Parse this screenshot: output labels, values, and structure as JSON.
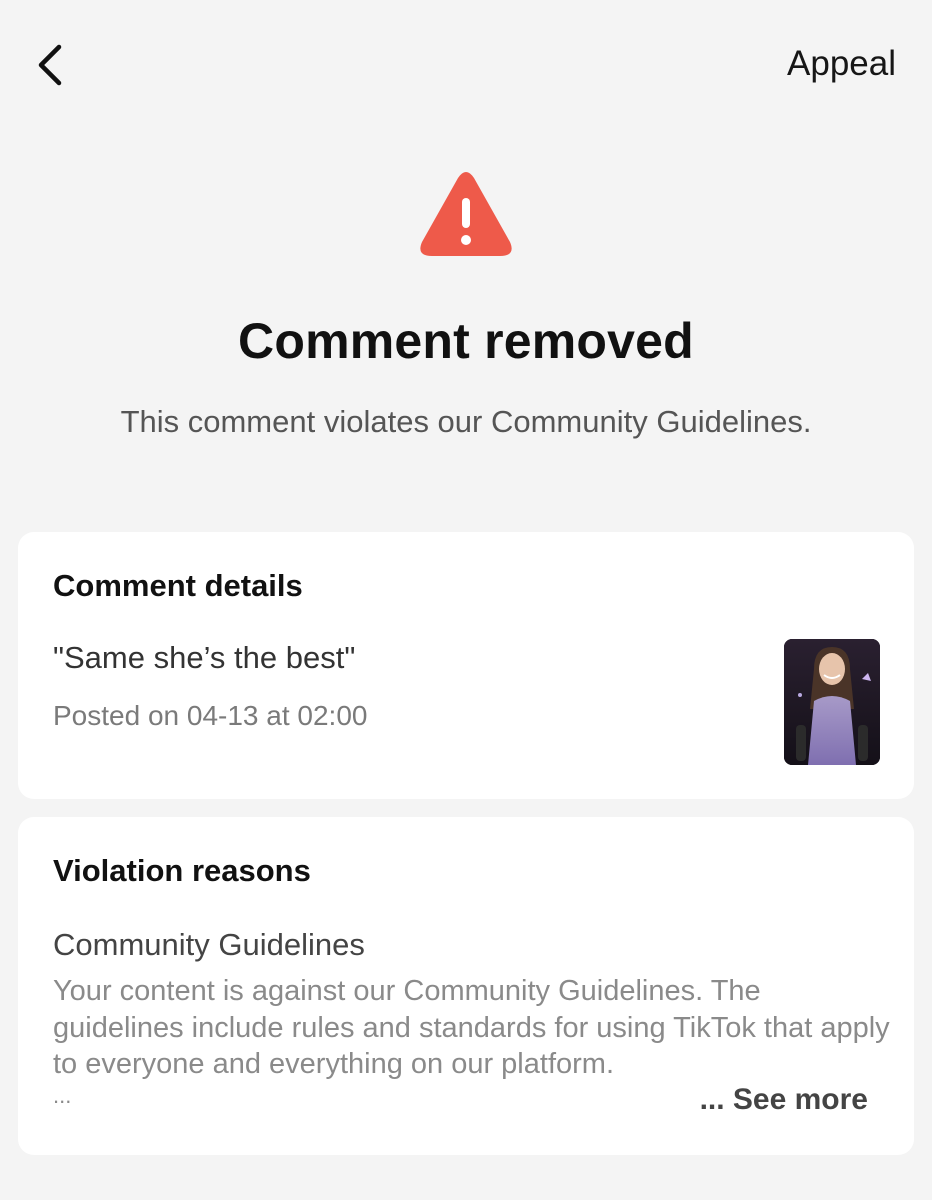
{
  "header": {
    "back_icon": "chevron-left-icon",
    "appeal_label": "Appeal"
  },
  "status": {
    "icon": "warning-triangle-icon",
    "icon_color": "#ee5a4a",
    "title": "Comment removed",
    "subtitle": "This comment violates our Community Guidelines."
  },
  "comment_details": {
    "heading": "Comment details",
    "comment_text": "\"Same she’s the best\"",
    "posted_text": "Posted on 04-13 at 02:00"
  },
  "violation": {
    "heading": "Violation reasons",
    "reason_title": "Community Guidelines",
    "reason_body": "Your content is against our Community Guidelines. The guidelines include rules and standards for using TikTok that apply to everyone and everything on our platform.",
    "ellipsis": "...",
    "see_more_label": "... See more"
  }
}
